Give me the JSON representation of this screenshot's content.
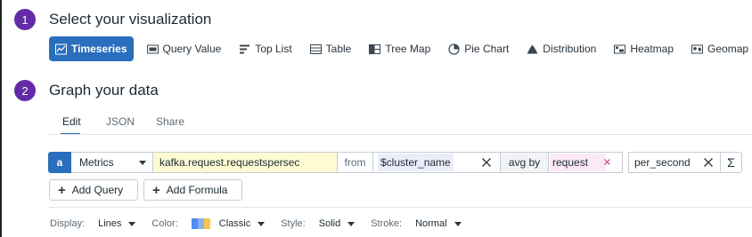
{
  "steps": {
    "one": {
      "number": "1",
      "title": "Select your visualization"
    },
    "two": {
      "number": "2",
      "title": "Graph your data"
    }
  },
  "visualizations": [
    {
      "label": "Timeseries",
      "icon": "timeseries-icon",
      "selected": true
    },
    {
      "label": "Query Value",
      "icon": "query-value-icon"
    },
    {
      "label": "Top List",
      "icon": "top-list-icon"
    },
    {
      "label": "Table",
      "icon": "table-icon"
    },
    {
      "label": "Tree Map",
      "icon": "tree-map-icon"
    },
    {
      "label": "Pie Chart",
      "icon": "pie-chart-icon"
    },
    {
      "label": "Distribution",
      "icon": "distribution-icon"
    },
    {
      "label": "Heatmap",
      "icon": "heatmap-icon"
    },
    {
      "label": "Geomap",
      "icon": "geomap-icon"
    }
  ],
  "tabs": [
    {
      "label": "Edit",
      "active": true
    },
    {
      "label": "JSON"
    },
    {
      "label": "Share"
    }
  ],
  "query": {
    "letter": "a",
    "source": "Metrics",
    "metric": "kafka.request.requestspersec",
    "from_label": "from",
    "scope": "$cluster_name",
    "aggregation": "avg by",
    "group_tag": "request",
    "function": "per_second",
    "sigma": "Σ"
  },
  "buttons": {
    "add_query": "Add Query",
    "add_formula": "Add Formula"
  },
  "display_options": {
    "display_label": "Display:",
    "display_value": "Lines",
    "color_label": "Color:",
    "color_value": "Classic",
    "style_label": "Style:",
    "style_value": "Solid",
    "stroke_label": "Stroke:",
    "stroke_value": "Normal"
  },
  "colors": {
    "accent": "#2a6fbd",
    "step_badge": "#632ca6",
    "metric_bg": "#fefbd3",
    "scope_bg": "#ebeefa",
    "tag_bg": "#fde8f6",
    "palette": [
      "#4d8ef0",
      "#8ab2f2",
      "#f7c549"
    ]
  }
}
